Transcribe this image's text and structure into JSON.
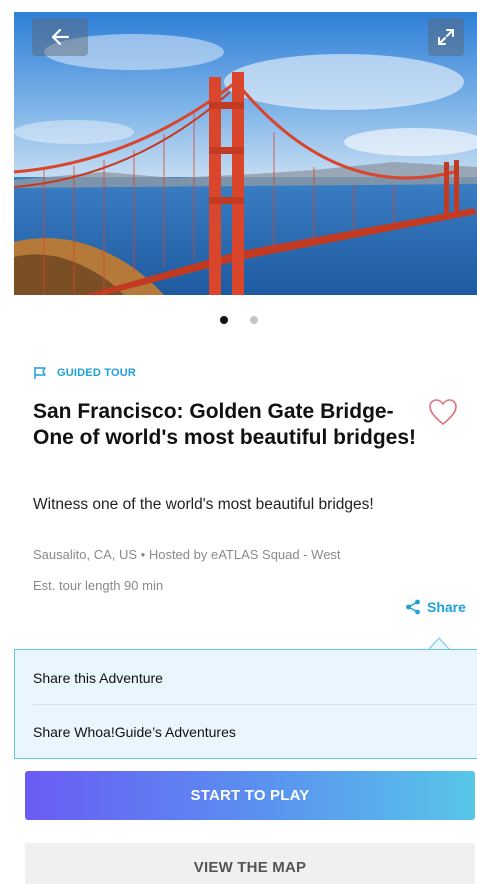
{
  "hero": {
    "image_description_icon": "photo-golden-gate-bridge",
    "back_icon": "arrow-left-icon",
    "expand_icon": "expand-icon"
  },
  "carousel": {
    "count": 2,
    "active": 0
  },
  "tour": {
    "tag": "GUIDED TOUR",
    "title": "San Francisco: Golden Gate Bridge- One of world's most beautiful bridges!",
    "subtitle": "Witness one of the world's most beautiful bridges!",
    "location_host": "Sausalito, CA, US • Hosted by eATLAS Squad - West",
    "length": "Est. tour length 90 min"
  },
  "share": {
    "label": "Share",
    "menu": [
      {
        "label": "Share this Adventure"
      },
      {
        "label": "Share Whoa!Guide’s Adventures"
      }
    ]
  },
  "actions": {
    "start": "START TO PLAY",
    "map": "VIEW THE MAP"
  },
  "colors": {
    "accent": "#1ea0d8",
    "heart": "#e4707a",
    "gradient_start": "#6a5cf5",
    "gradient_end": "#57c6e8"
  }
}
